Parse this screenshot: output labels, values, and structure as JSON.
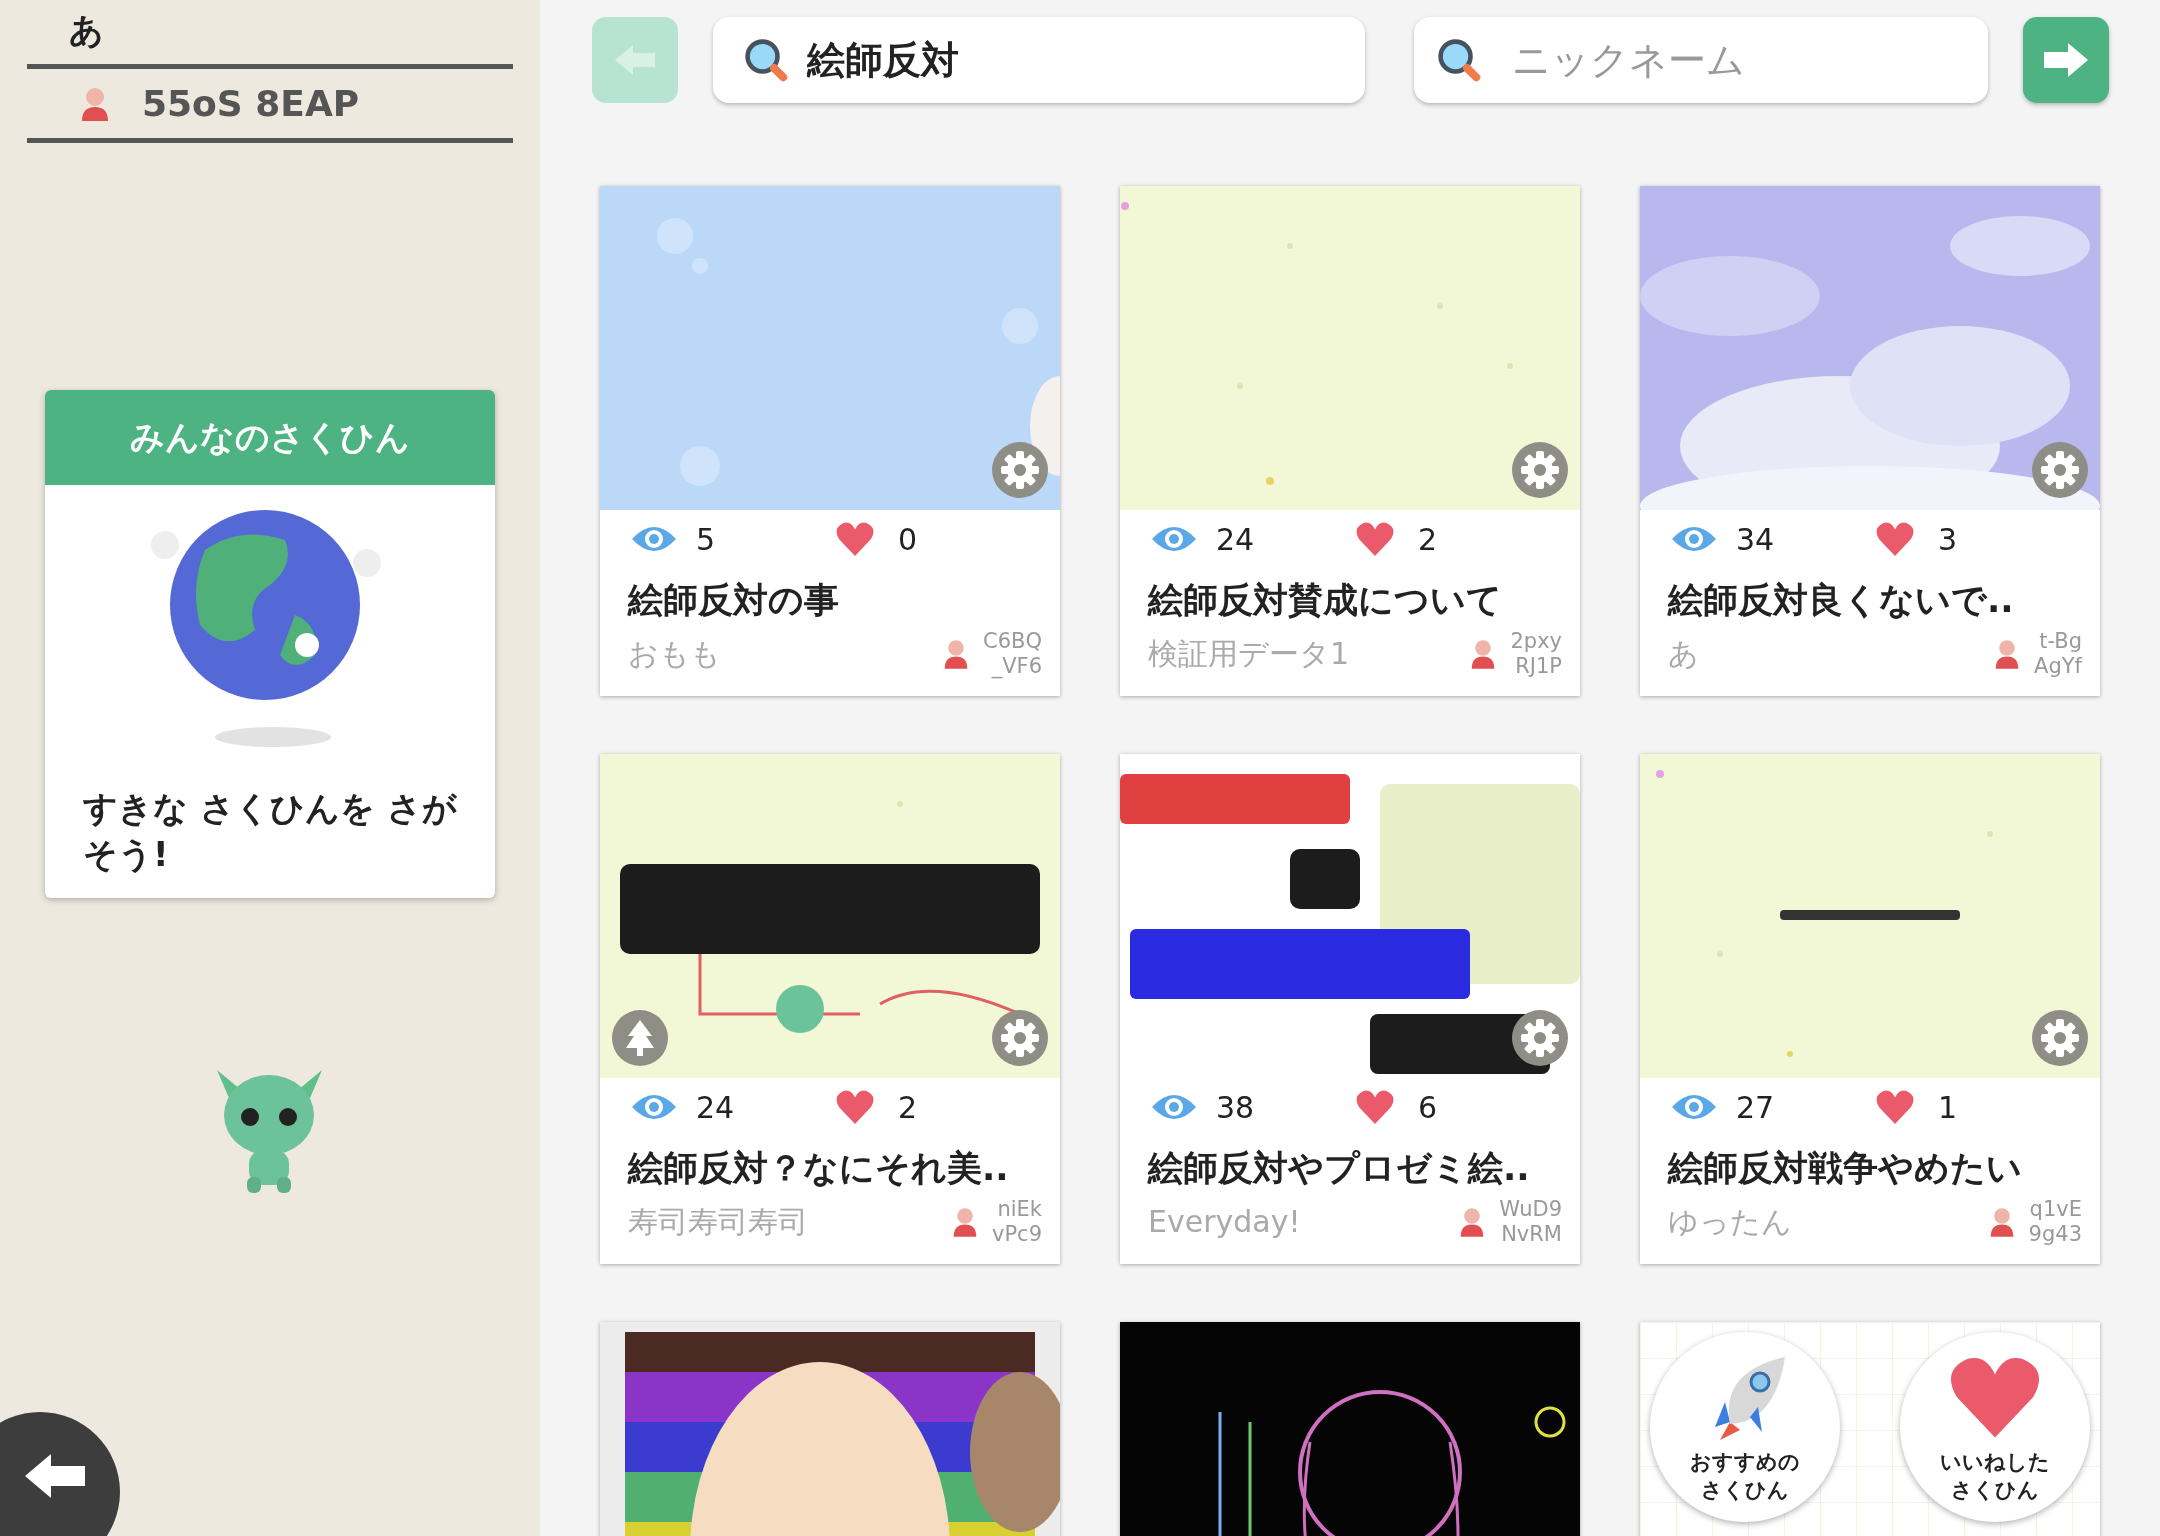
{
  "sidebar": {
    "user_name": "あ",
    "user_id": "55oS 8EAP",
    "panel": {
      "title": "みんなのさくひん",
      "message": "すきな さくひんを さがそう!"
    }
  },
  "toolbar": {
    "back_disabled": true,
    "search": {
      "value": "絵師反対"
    },
    "nickname": {
      "placeholder": "ニックネーム"
    }
  },
  "cards": [
    {
      "kind": "work",
      "views": "5",
      "likes": "0",
      "title": "絵師反対の事",
      "author": "おもも",
      "id_lines": [
        "C6BQ",
        "_VF6"
      ],
      "tree_badge": false
    },
    {
      "kind": "work",
      "views": "24",
      "likes": "2",
      "title": "絵師反対賛成について",
      "author": "検証用データ1",
      "id_lines": [
        "2pxy",
        "RJ1P"
      ],
      "tree_badge": false
    },
    {
      "kind": "work",
      "views": "34",
      "likes": "3",
      "title": "絵師反対良くないで..",
      "author": "あ",
      "id_lines": [
        "t-Bg",
        "AgYf"
      ],
      "tree_badge": false
    },
    {
      "kind": "work",
      "views": "24",
      "likes": "2",
      "title": "絵師反対？なにそれ美..",
      "author": "寿司寿司寿司",
      "id_lines": [
        "niEk",
        "vPc9"
      ],
      "tree_badge": true
    },
    {
      "kind": "work",
      "views": "38",
      "likes": "6",
      "title": "絵師反対やプロゼミ絵..",
      "author": "Everyday!",
      "id_lines": [
        "WuD9",
        "NvRM"
      ],
      "tree_badge": false
    },
    {
      "kind": "work",
      "views": "27",
      "likes": "1",
      "title": "絵師反対戦争やめたい",
      "author": "ゆったん",
      "id_lines": [
        "q1vE",
        "9g43"
      ],
      "tree_badge": false
    },
    {
      "kind": "cut"
    },
    {
      "kind": "cut"
    },
    {
      "kind": "menu",
      "buttons": [
        {
          "label": "おすすめのさくひん"
        },
        {
          "label": "いいねしたさくひん"
        }
      ]
    }
  ]
}
